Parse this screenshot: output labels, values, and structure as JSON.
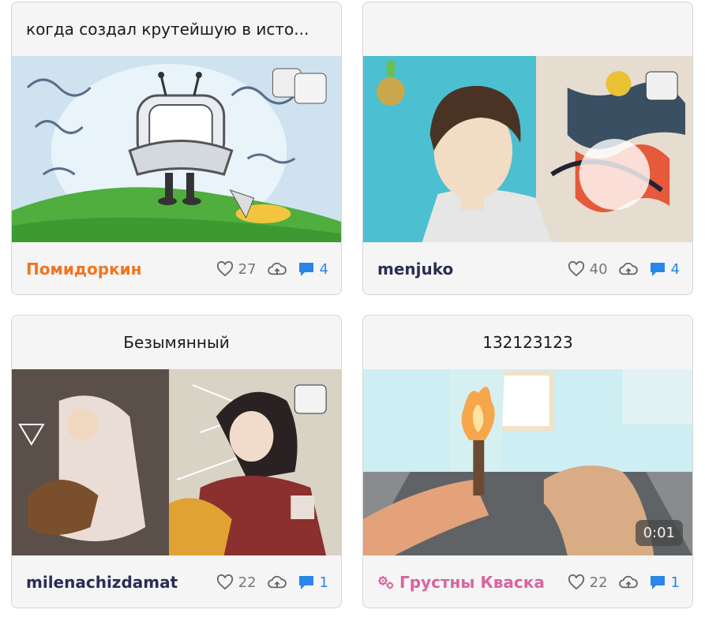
{
  "colors": {
    "orange_author": "#f07422",
    "navy_author": "#2b2d54",
    "pink_author": "#d9649e",
    "comment_blue": "#2a86e8"
  },
  "cards": [
    {
      "title": "когда создал крутейшую в исто...",
      "author": "Помидоркин",
      "likes": "27",
      "comments": "4"
    },
    {
      "title": "",
      "author": "menjuko",
      "likes": "40",
      "comments": "4"
    },
    {
      "title": "Безымянный",
      "author": "milenachizdamat",
      "likes": "22",
      "comments": "1"
    },
    {
      "title": "132123123",
      "author": "Грустны Кваска",
      "author_icon": "gears-icon",
      "likes": "22",
      "comments": "1",
      "video_duration": "0:01"
    }
  ],
  "icons": {
    "like": "heart-icon",
    "repost": "cloud-upload-icon",
    "comment": "comment-bubble-icon"
  }
}
